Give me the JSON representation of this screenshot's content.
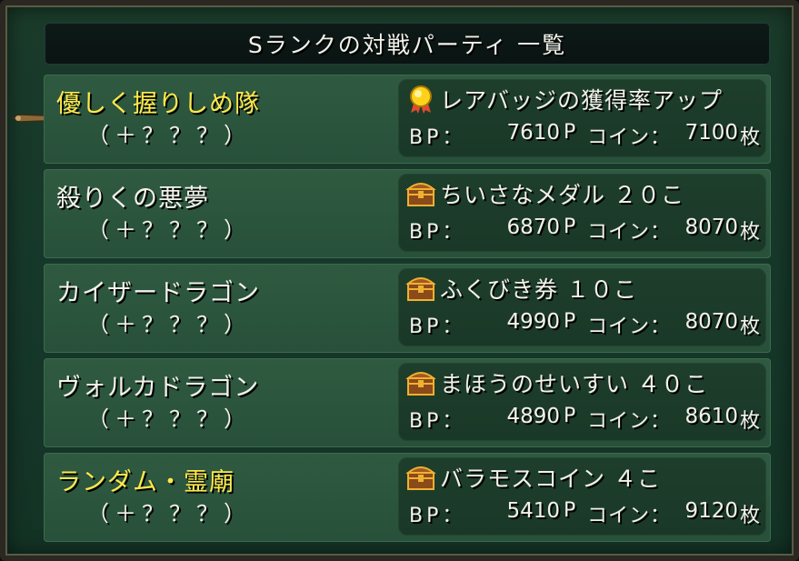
{
  "title": "Sランクの対戦パーティ 一覧",
  "bp_label": "BP：",
  "p_unit": "P",
  "coin_label": "コイン：",
  "coin_unit": "枚",
  "parties": [
    {
      "name": "優しく握りしめ隊",
      "sub": "（＋？？？）",
      "highlight": true,
      "reward_icon": "badge-icon",
      "reward": "レアバッジの獲得率アップ",
      "bp": "7610",
      "coin": "7100"
    },
    {
      "name": "殺りくの悪夢",
      "sub": "（＋？？？）",
      "highlight": false,
      "reward_icon": "treasure-chest-icon",
      "reward": "ちいさなメダル ２０こ",
      "bp": "6870",
      "coin": "8070"
    },
    {
      "name": "カイザードラゴン",
      "sub": "（＋？？？）",
      "highlight": false,
      "reward_icon": "treasure-chest-icon",
      "reward": "ふくびき券 １０こ",
      "bp": "4990",
      "coin": "8070"
    },
    {
      "name": "ヴォルカドラゴン",
      "sub": "（＋？？？）",
      "highlight": false,
      "reward_icon": "treasure-chest-icon",
      "reward": "まほうのせいすい ４０こ",
      "bp": "4890",
      "coin": "8610"
    },
    {
      "name": "ランダム・霊廟",
      "sub": "（＋？？？）",
      "highlight": true,
      "reward_icon": "treasure-chest-icon",
      "reward": "バラモスコイン ４こ",
      "bp": "5410",
      "coin": "9120"
    }
  ],
  "colors": {
    "highlight_text": "#ffe94a",
    "normal_text": "#f2f2ea",
    "panel_bg": "#2f5a40"
  }
}
